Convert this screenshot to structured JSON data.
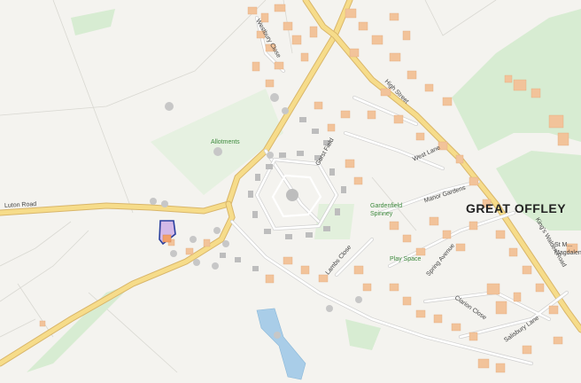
{
  "map": {
    "place_name": "GREAT OFFLEY",
    "labels": {
      "luton_road": "Luton Road",
      "allotments": "Allotments",
      "high_street": "High Street",
      "westbury_close": "Westbury Close",
      "gorst_field": "Gorst Field",
      "west_lane": "West Lane",
      "manor_gardens": "Manor Gardens",
      "gardenfield_spinney": "Gardenfield Spinney",
      "play_space": "Play Space",
      "lambs_close": "Lambs Close",
      "kings_walden_road": "King's Walden Road",
      "spring_avenue": "Spring Avenue",
      "clarion_close": "Clarion Close",
      "salisbury_lane": "Salisbury Lane",
      "st_mary_magdalene": "St M... Magdalen..."
    },
    "colors": {
      "background": "#f4f3ef",
      "road_major": "#f6dc8a",
      "road_casing": "#d9b66a",
      "road_minor": "#ffffff",
      "building": "#f2c39a",
      "woodland": "#d7ecd2",
      "water": "#a9cde8",
      "boundary": "#2a3f9e",
      "boundary_fill": "#c9a6e6"
    }
  }
}
